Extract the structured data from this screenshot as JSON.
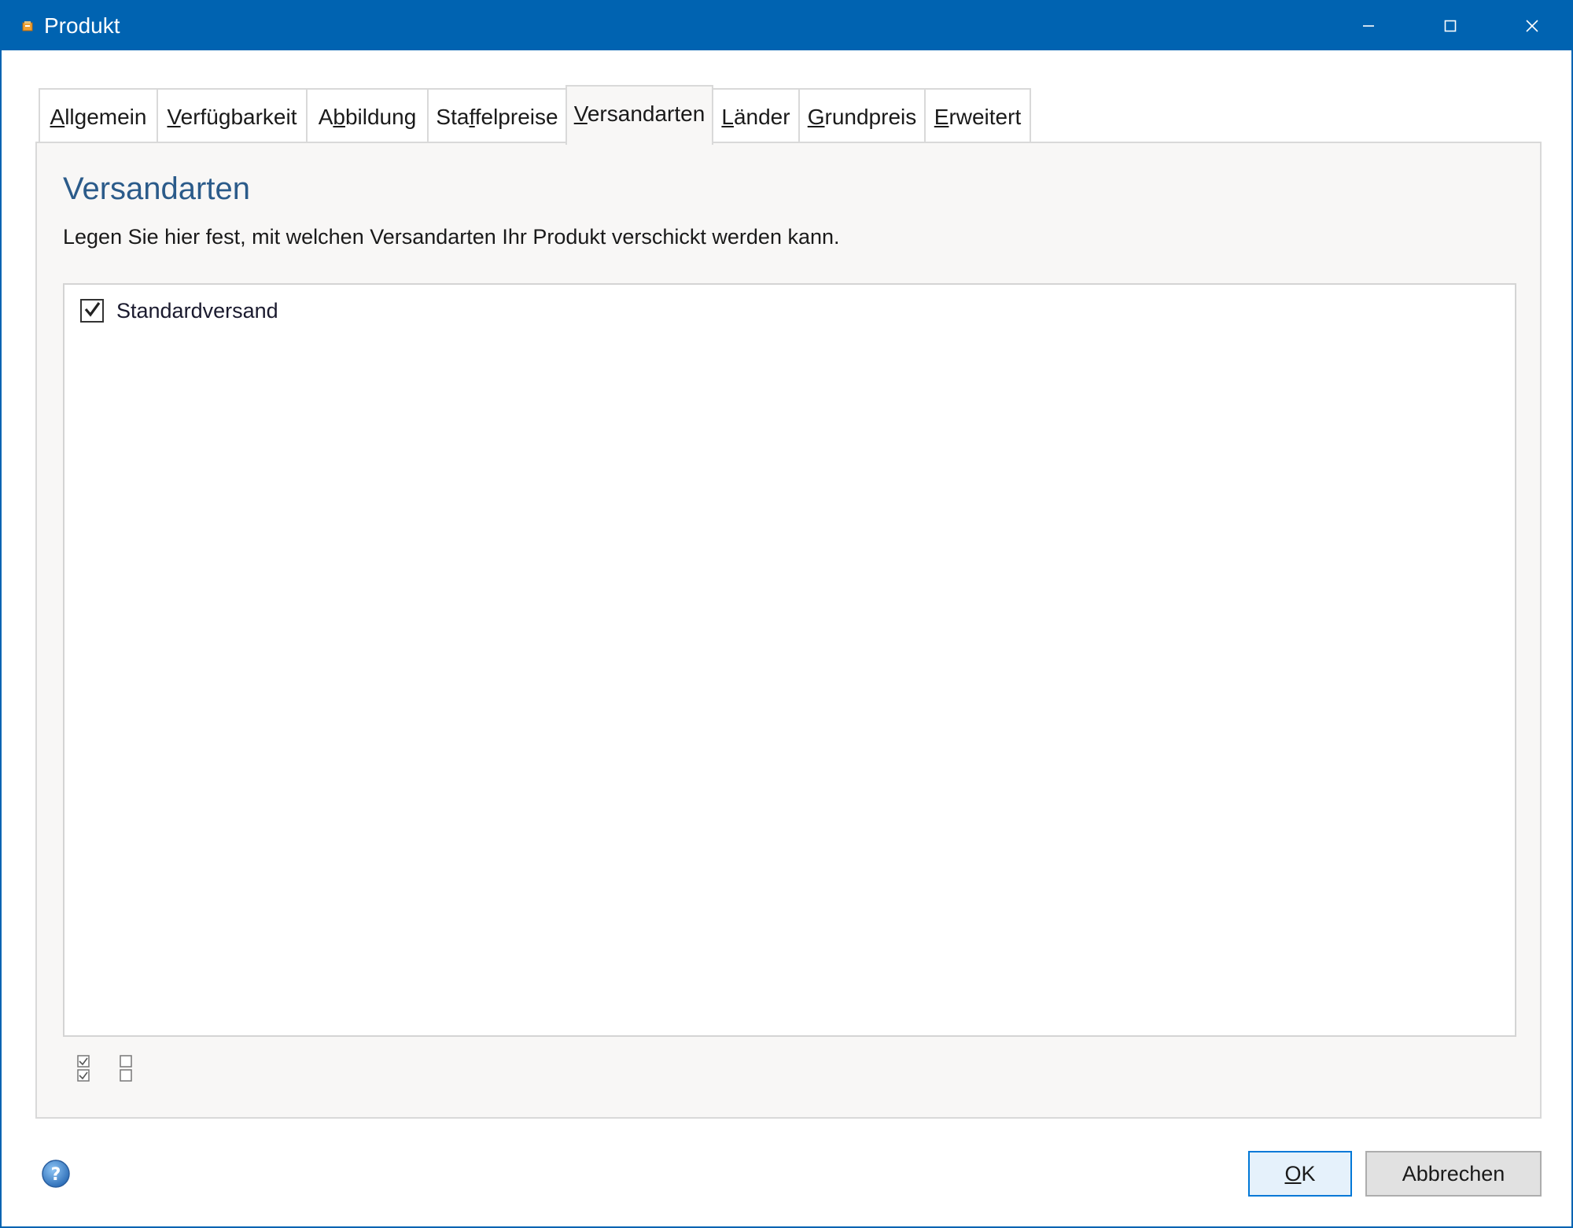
{
  "window": {
    "title": "Produkt",
    "accent_color": "#0063b1",
    "controls": [
      "minimize-icon",
      "maximize-icon",
      "close-icon"
    ]
  },
  "tabs": [
    {
      "label_pre": "",
      "label_key": "A",
      "label_post": "llgemein"
    },
    {
      "label_pre": "",
      "label_key": "V",
      "label_post": "erfügbarkeit"
    },
    {
      "label_pre": "A",
      "label_key": "b",
      "label_post": "bildung"
    },
    {
      "label_pre": "Sta",
      "label_key": "f",
      "label_post": "felpreise"
    },
    {
      "label_pre": "",
      "label_key": "V",
      "label_post": "ersandarten",
      "active": true
    },
    {
      "label_pre": "",
      "label_key": "L",
      "label_post": "änder"
    },
    {
      "label_pre": "",
      "label_key": "G",
      "label_post": "rundpreis"
    },
    {
      "label_pre": "",
      "label_key": "E",
      "label_post": "rweitert"
    }
  ],
  "panel": {
    "heading": "Versandarten",
    "description": "Legen Sie hier fest, mit welchen Versandarten Ihr Produkt verschickt werden kann.",
    "items": [
      {
        "label": "Standardversand",
        "checked": true
      }
    ],
    "tools": [
      "select-all-icon",
      "select-none-icon"
    ]
  },
  "footer": {
    "help": "help-icon",
    "ok_key": "O",
    "ok_rest": "K",
    "cancel_label": "Abbrechen"
  }
}
